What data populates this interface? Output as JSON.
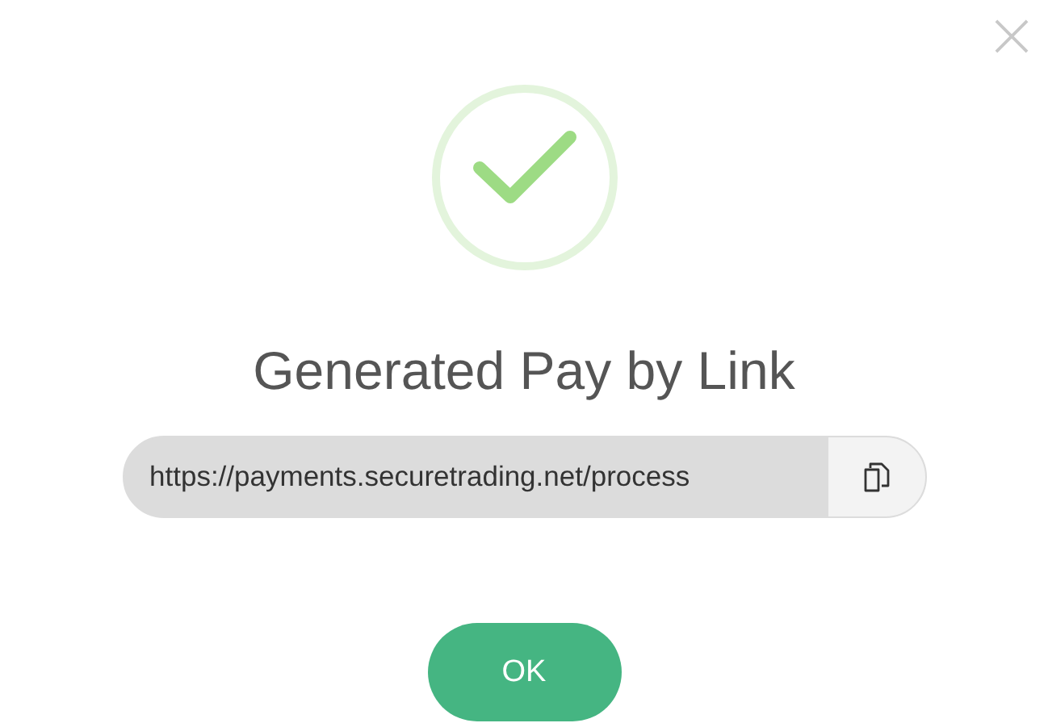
{
  "dialog": {
    "title": "Generated Pay by Link",
    "link_field": {
      "value": "https://payments.securetrading.net/process"
    },
    "buttons": [
      {
        "label": "OK",
        "kind": "primary"
      }
    ]
  }
}
